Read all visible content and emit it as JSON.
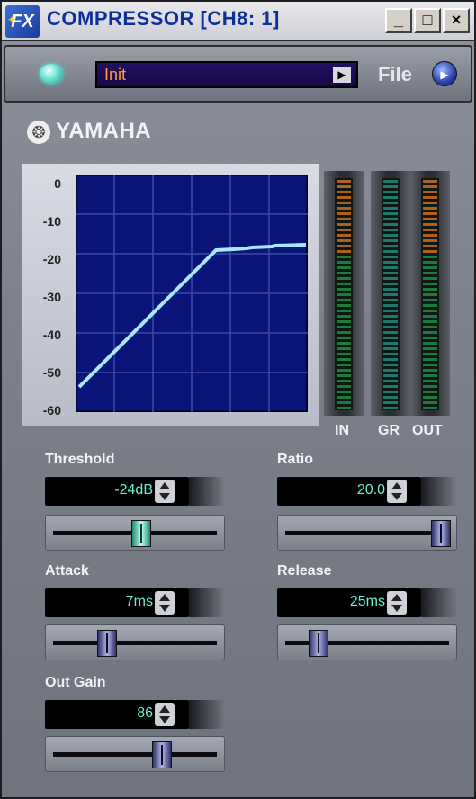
{
  "window": {
    "title": "COMPRESSOR [CH8: 1]",
    "minimize": "_",
    "maximize": "□",
    "close": "×"
  },
  "preset": {
    "name": "Init",
    "file_label": "File"
  },
  "brand": {
    "name": "YAMAHA"
  },
  "graph": {
    "y_ticks": [
      "0",
      "-10",
      "-20",
      "-30",
      "-40",
      "-50",
      "-60"
    ],
    "curve_color": "#a8e8ff",
    "background_color": "#0a1478",
    "grid_color": "#3a4aa8"
  },
  "meters": {
    "in_label": "IN",
    "gr_label": "GR",
    "out_label": "OUT"
  },
  "params": {
    "threshold": {
      "label": "Threshold",
      "value": "-24dB",
      "slider_fraction": 0.54
    },
    "ratio": {
      "label": "Ratio",
      "value": "20.0",
      "slider_fraction": 1.0
    },
    "attack": {
      "label": "Attack",
      "value": "7ms",
      "slider_fraction": 0.31
    },
    "release": {
      "label": "Release",
      "value": "25ms",
      "slider_fraction": 0.17
    },
    "out_gain": {
      "label": "Out Gain",
      "value": "86",
      "slider_fraction": 0.68
    }
  },
  "colors": {
    "value_text": "#68f0d4",
    "meter_hot": "#b0601c",
    "meter_normal": "#1e7a3a",
    "meter_gr": "#1e7a6e"
  }
}
